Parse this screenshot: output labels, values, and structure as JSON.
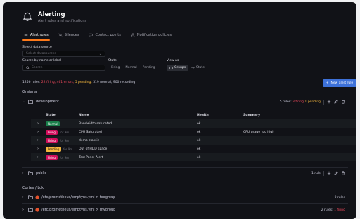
{
  "header": {
    "title": "Alerting",
    "subtitle": "Alert rules and notifications"
  },
  "tabs": [
    {
      "label": "Alert rules",
      "active": true,
      "icon": "list-icon"
    },
    {
      "label": "Silences",
      "active": false,
      "icon": "bell-slash-icon"
    },
    {
      "label": "Contact points",
      "active": false,
      "icon": "comment-icon"
    },
    {
      "label": "Notification policies",
      "active": false,
      "icon": "sitemap-icon"
    }
  ],
  "filters": {
    "datasource_label": "Select data source",
    "datasource_placeholder": "Select datasources",
    "search_label": "Search by name or label",
    "search_placeholder": "Search",
    "state_label": "State",
    "states": [
      "Firing",
      "Normal",
      "Pending"
    ],
    "view_label": "View as",
    "views": [
      "Groups",
      "State"
    ],
    "view_selected": "Groups"
  },
  "summary": {
    "total": "1256 rules:",
    "firing": "22 firing,",
    "errors": "461 errors,",
    "pending": "5 pending,",
    "rest": "319 normal, 900 recording"
  },
  "new_rule_label": "New alert rule",
  "sections": {
    "grafana": "Grafana",
    "cortex": "Cortex / Loki"
  },
  "groups": {
    "development": {
      "name": "development",
      "count": "5 rules:",
      "firing": "3 firing",
      "pending": "1 pending"
    },
    "public": {
      "name": "public",
      "count": "1 rule"
    },
    "foogroup": {
      "name": "/etc/prometheus/emptyns.yml > foogroup",
      "count": "0 rules"
    },
    "mygroup": {
      "name": "/etc/prometheus/emptyns.yml > mygroup",
      "count": "2 rules:",
      "firing": "1 firing"
    }
  },
  "table": {
    "headers": {
      "state": "State",
      "name": "Name",
      "health": "Health",
      "summary": "Summary"
    },
    "rows": [
      {
        "state": "Normal",
        "for": "",
        "name": "Bandwidth saturated",
        "health": "ok",
        "summary": ""
      },
      {
        "state": "Firing",
        "for": "for 9m",
        "name": "CPU Saturated",
        "health": "ok",
        "summary": "CPU usage too high"
      },
      {
        "state": "Firing",
        "for": "for 9m",
        "name": "demo classic",
        "health": "ok",
        "summary": ""
      },
      {
        "state": "Pending",
        "for": "for 9m",
        "name": "Out of HDD space",
        "health": "ok",
        "summary": ""
      },
      {
        "state": "Firing",
        "for": "for 9m",
        "name": "Test Panel Alert",
        "health": "ok",
        "summary": ""
      }
    ]
  },
  "colors": {
    "accent": "#ff7a1a",
    "primary_button": "#3d71d9",
    "firing": "#d10e5c",
    "pending": "#f5b73d",
    "normal": "#1a7f4b"
  }
}
